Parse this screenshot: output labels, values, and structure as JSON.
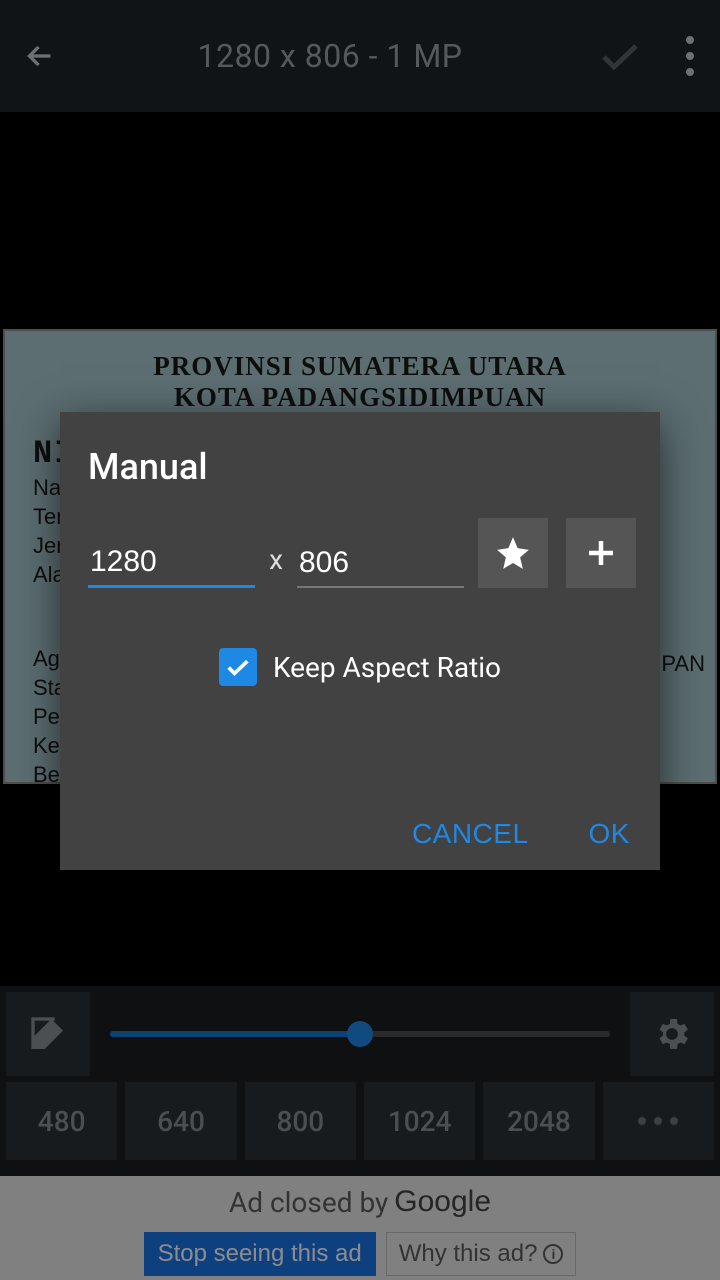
{
  "topbar": {
    "title": "1280 x 806 - 1 MP"
  },
  "card": {
    "line1": "PROVINSI SUMATERA UTARA",
    "line2": "KOTA PADANGSIDIMPUAN",
    "nik_label": "NI",
    "rows_top": [
      "Nan",
      "Tem",
      "Jen",
      "Alam"
    ],
    "rows_bottom": [
      "Aga",
      "Stat",
      "Pek",
      "Kew",
      "Ber"
    ],
    "right_label": "PAN"
  },
  "slider": {
    "fill_pct": 50
  },
  "presets": [
    "480",
    "640",
    "800",
    "1024",
    "2048"
  ],
  "ad": {
    "closed_text": "Ad closed by",
    "google": "Google",
    "stop": "Stop seeing this ad",
    "why": "Why this ad?"
  },
  "dialog": {
    "title": "Manual",
    "width_value": "1280",
    "height_value": "806",
    "x": "x",
    "aspect_label": "Keep Aspect Ratio",
    "aspect_checked": true,
    "cancel": "CANCEL",
    "ok": "OK"
  }
}
